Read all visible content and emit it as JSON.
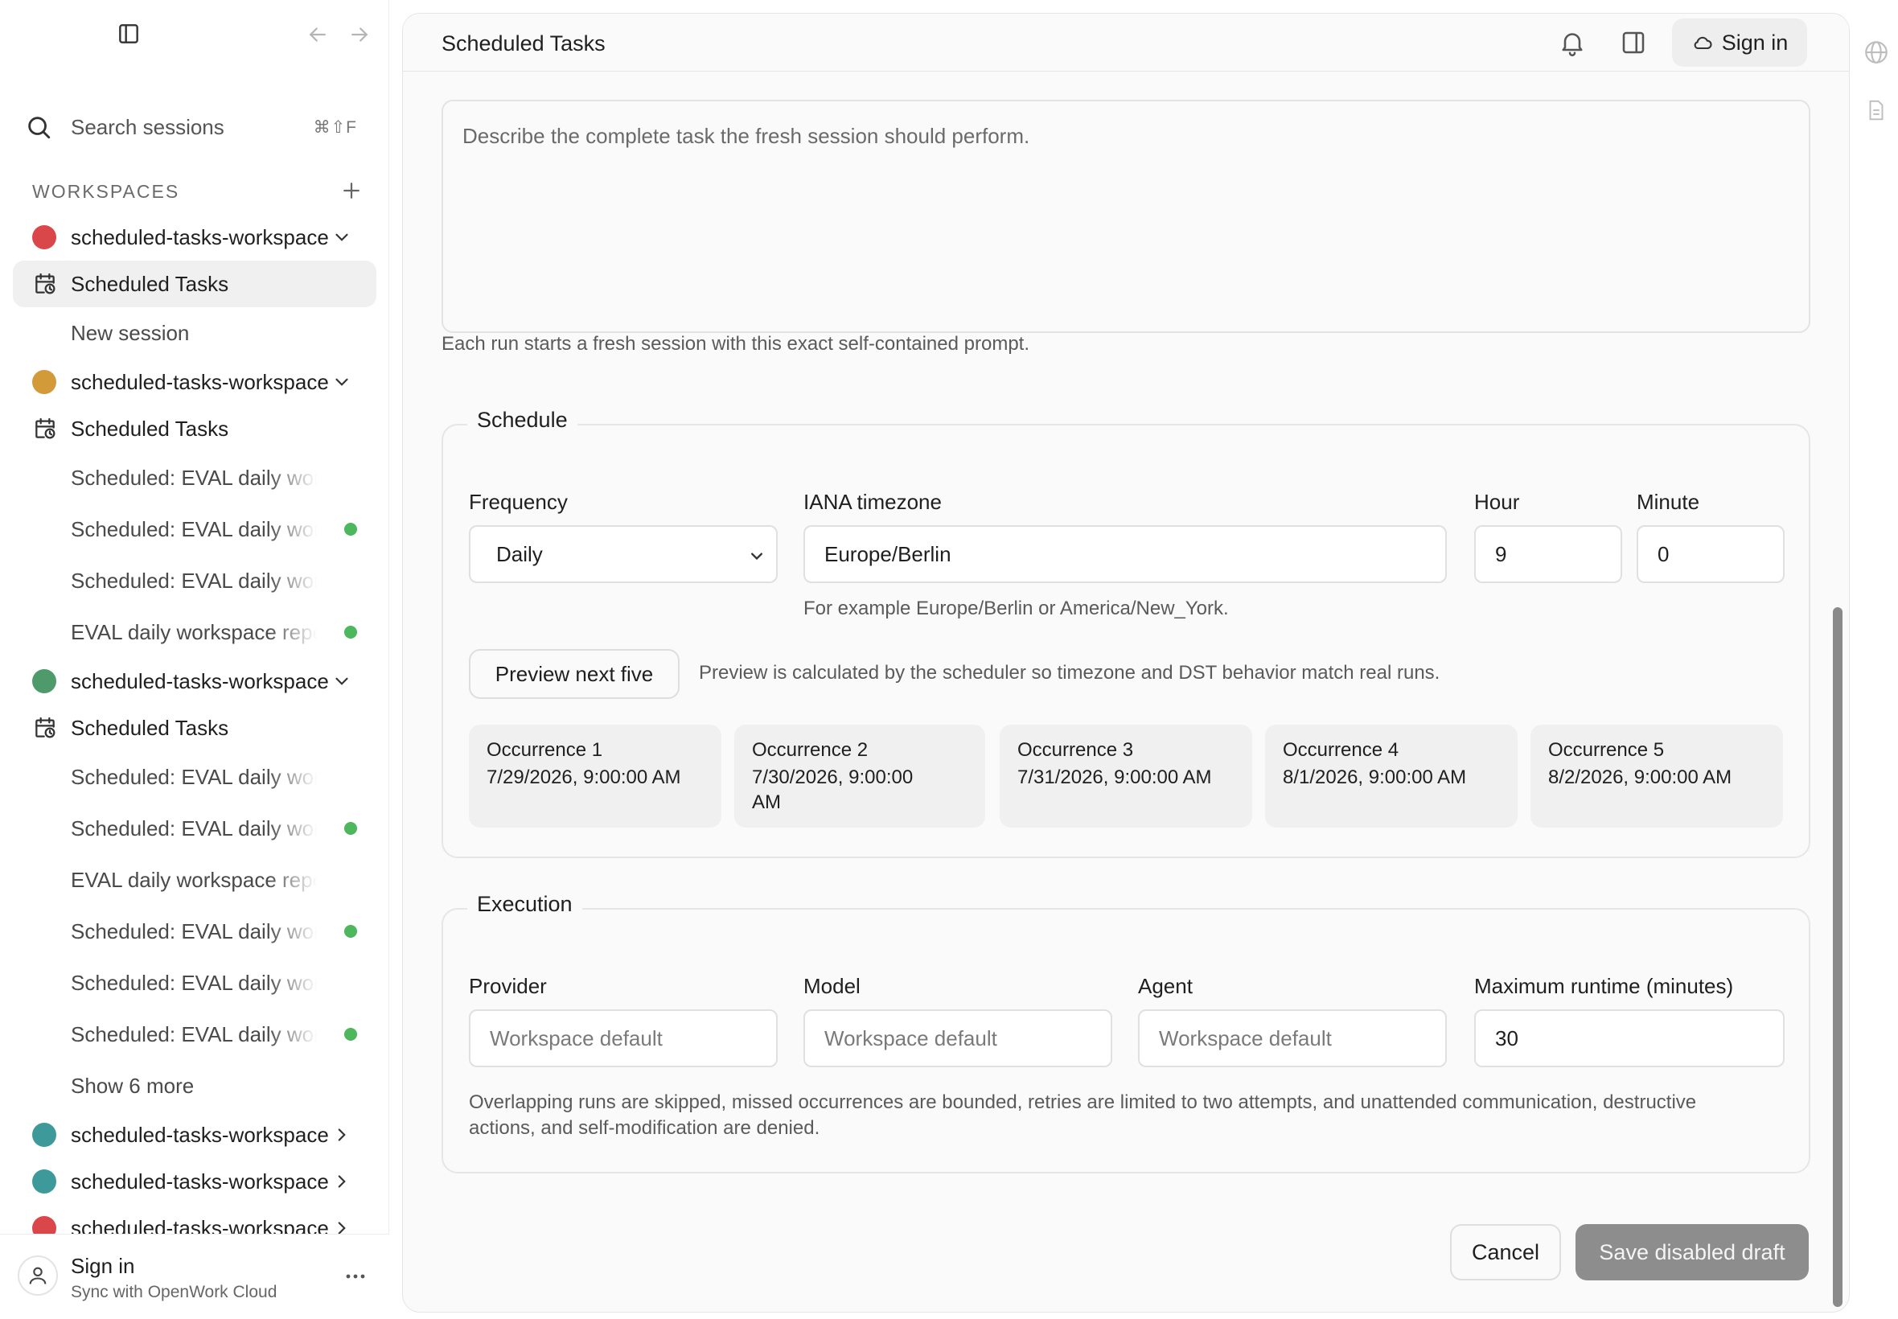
{
  "sidebar": {
    "search": {
      "label": "Search sessions",
      "shortcut": "⌘⇧F"
    },
    "workspaces_heading": "WORKSPACES",
    "rows": [
      {
        "kind": "ws",
        "label": "scheduled-tasks-workspace",
        "color": "#d9474b",
        "expanded": true
      },
      {
        "kind": "tasks",
        "label": "Scheduled Tasks",
        "active": true
      },
      {
        "kind": "session",
        "label": "New session",
        "live": false
      },
      {
        "kind": "ws",
        "label": "scheduled-tasks-workspace",
        "color": "#d39a3a",
        "expanded": true
      },
      {
        "kind": "tasks",
        "label": "Scheduled Tasks",
        "active": false
      },
      {
        "kind": "session",
        "label": "Scheduled: EVAL daily workspace",
        "live": false
      },
      {
        "kind": "session",
        "label": "Scheduled: EVAL daily workspace",
        "live": true
      },
      {
        "kind": "session",
        "label": "Scheduled: EVAL daily workspace",
        "live": false
      },
      {
        "kind": "session",
        "label": "EVAL daily workspace report",
        "live": true
      },
      {
        "kind": "ws",
        "label": "scheduled-tasks-workspace",
        "color": "#4e9a6a",
        "expanded": true
      },
      {
        "kind": "tasks",
        "label": "Scheduled Tasks",
        "active": false
      },
      {
        "kind": "session",
        "label": "Scheduled: EVAL daily workspace",
        "live": false
      },
      {
        "kind": "session",
        "label": "Scheduled: EVAL daily workspace",
        "live": true
      },
      {
        "kind": "session",
        "label": "EVAL daily workspace report",
        "live": false
      },
      {
        "kind": "session",
        "label": "Scheduled: EVAL daily workspace",
        "live": true
      },
      {
        "kind": "session",
        "label": "Scheduled: EVAL daily workspace",
        "live": false
      },
      {
        "kind": "session",
        "label": "Scheduled: EVAL daily workspace",
        "live": true
      },
      {
        "kind": "more",
        "label": "Show 6 more"
      },
      {
        "kind": "ws",
        "label": "scheduled-tasks-workspace",
        "color": "#3e9a9a",
        "expanded": false
      },
      {
        "kind": "ws",
        "label": "scheduled-tasks-workspace",
        "color": "#3e9a9a",
        "expanded": false
      },
      {
        "kind": "ws",
        "label": "scheduled-tasks-workspace",
        "color": "#d9474b",
        "expanded": false
      }
    ],
    "footer": {
      "name": "Sign in",
      "sub": "Sync with OpenWork Cloud"
    }
  },
  "topbar": {
    "title": "Scheduled Tasks",
    "signin": "Sign in"
  },
  "prompt": {
    "placeholder": "Describe the complete task the fresh session should perform.",
    "help": "Each run starts a fresh session with this exact self-contained prompt."
  },
  "schedule": {
    "legend": "Schedule",
    "frequency_label": "Frequency",
    "frequency_value": "Daily",
    "timezone_label": "IANA timezone",
    "timezone_value": "Europe/Berlin",
    "timezone_hint": "For example Europe/Berlin or America/New_York.",
    "hour_label": "Hour",
    "hour_value": "9",
    "minute_label": "Minute",
    "minute_value": "0",
    "preview_button": "Preview next five",
    "preview_note": "Preview is calculated by the scheduler so timezone and DST behavior match real runs.",
    "occurrences": [
      {
        "name": "Occurrence 1",
        "date": "7/29/2026, 9:00:00 AM"
      },
      {
        "name": "Occurrence 2",
        "date": "7/30/2026, 9:00:00 AM"
      },
      {
        "name": "Occurrence 3",
        "date": "7/31/2026, 9:00:00 AM"
      },
      {
        "name": "Occurrence 4",
        "date": "8/1/2026, 9:00:00 AM"
      },
      {
        "name": "Occurrence 5",
        "date": "8/2/2026, 9:00:00 AM"
      }
    ]
  },
  "execution": {
    "legend": "Execution",
    "provider_label": "Provider",
    "provider_placeholder": "Workspace default",
    "model_label": "Model",
    "model_placeholder": "Workspace default",
    "agent_label": "Agent",
    "agent_placeholder": "Workspace default",
    "runtime_label": "Maximum runtime (minutes)",
    "runtime_value": "30",
    "note": "Overlapping runs are skipped, missed occurrences are bounded, retries are limited to two attempts, and unattended communication, destructive actions, and self-modification are denied."
  },
  "actions": {
    "cancel": "Cancel",
    "save": "Save disabled draft"
  },
  "colors": {
    "live_dot": "#4cb75c",
    "save_disabled_bg": "#8d8d8d"
  }
}
